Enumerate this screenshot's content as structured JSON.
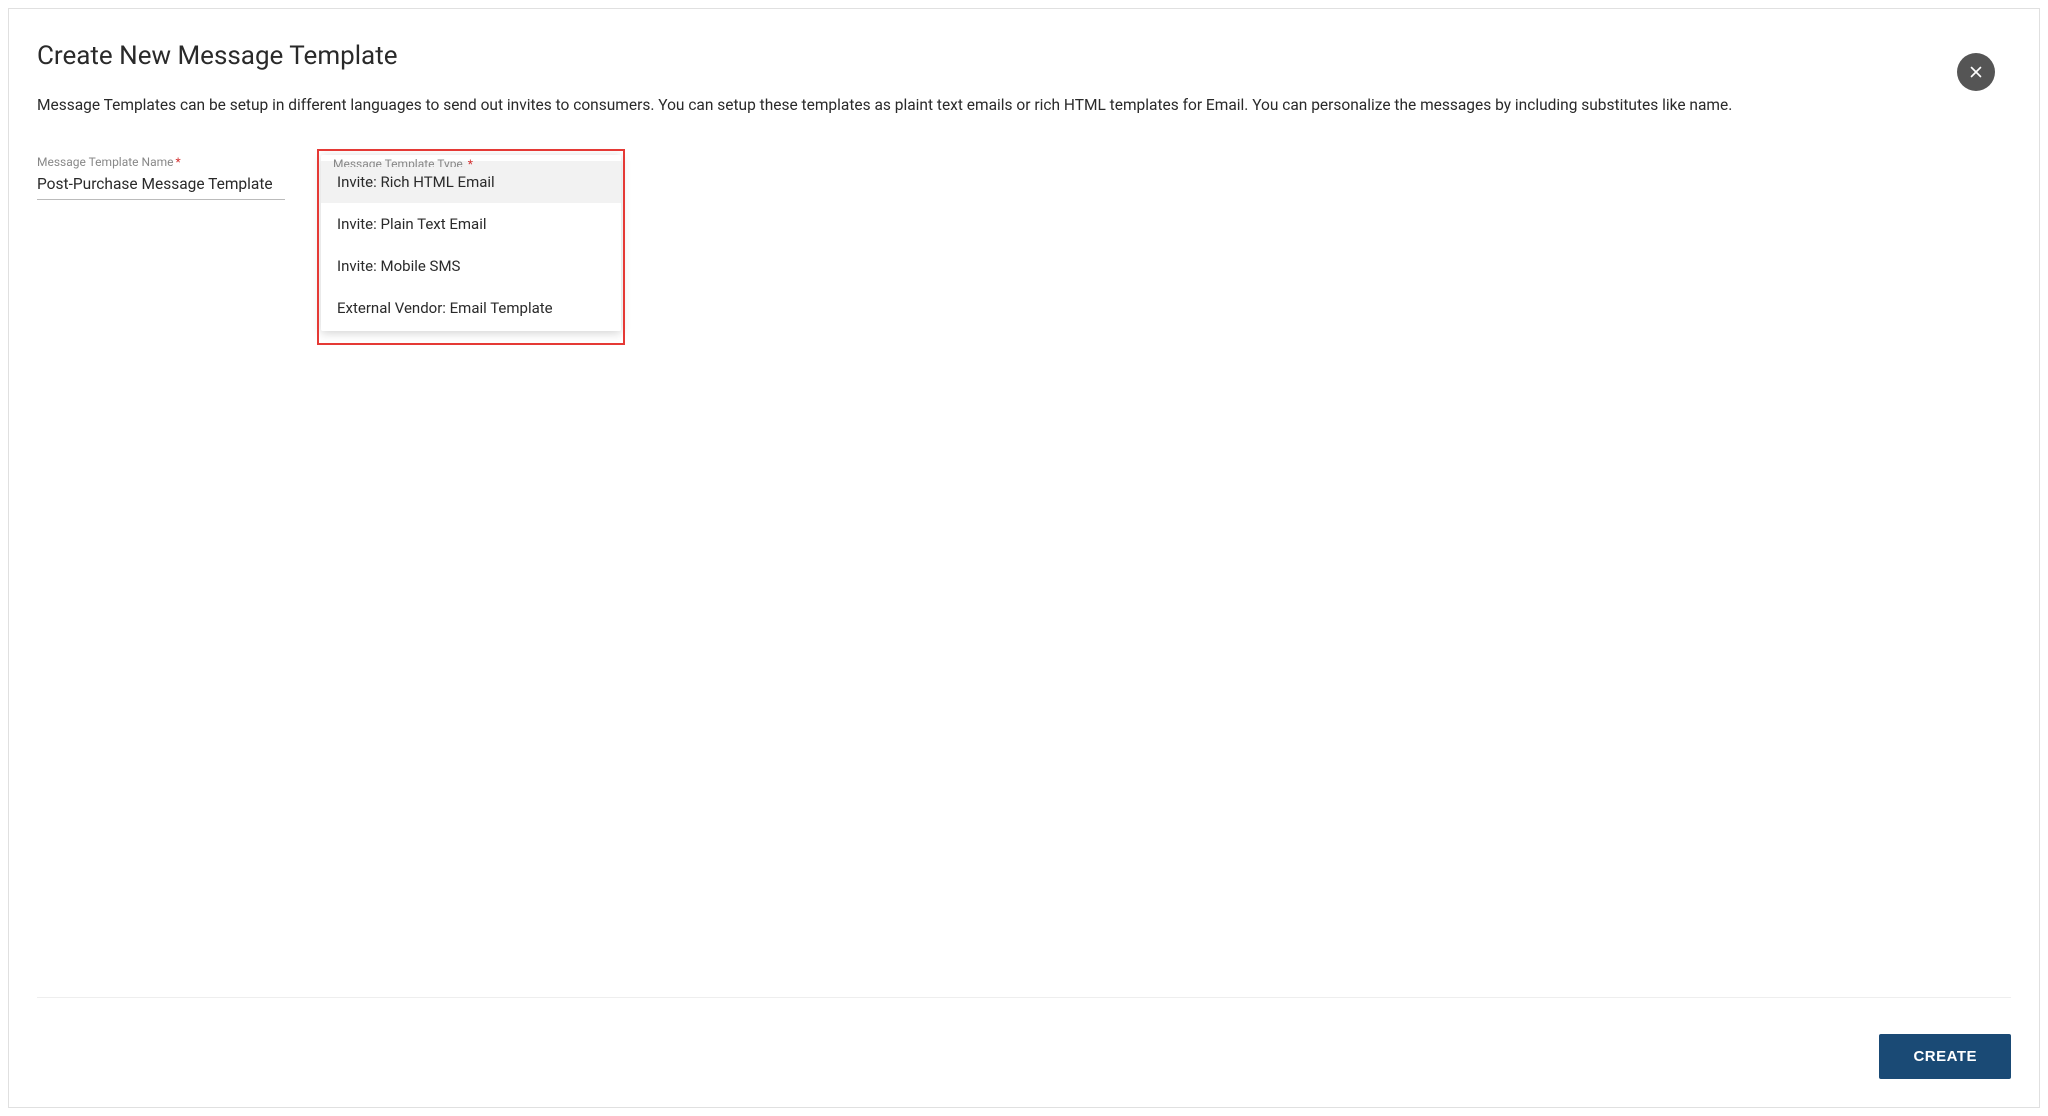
{
  "dialog": {
    "title": "Create New Message Template",
    "description": "Message Templates can be setup in different languages to send out invites to consumers. You can setup these templates as plaint text emails or rich HTML templates for Email. You can personalize the messages by including substitutes like name."
  },
  "fields": {
    "name": {
      "label": "Message Template Name",
      "required_marker": "*",
      "value": "Post-Purchase Message Template"
    },
    "type": {
      "label": "Message Template Type",
      "required_marker": "*",
      "options": [
        "Invite: Rich HTML Email",
        "Invite: Plain Text Email",
        "Invite: Mobile SMS",
        "External Vendor: Email Template"
      ]
    }
  },
  "footer": {
    "create_label": "CREATE"
  }
}
